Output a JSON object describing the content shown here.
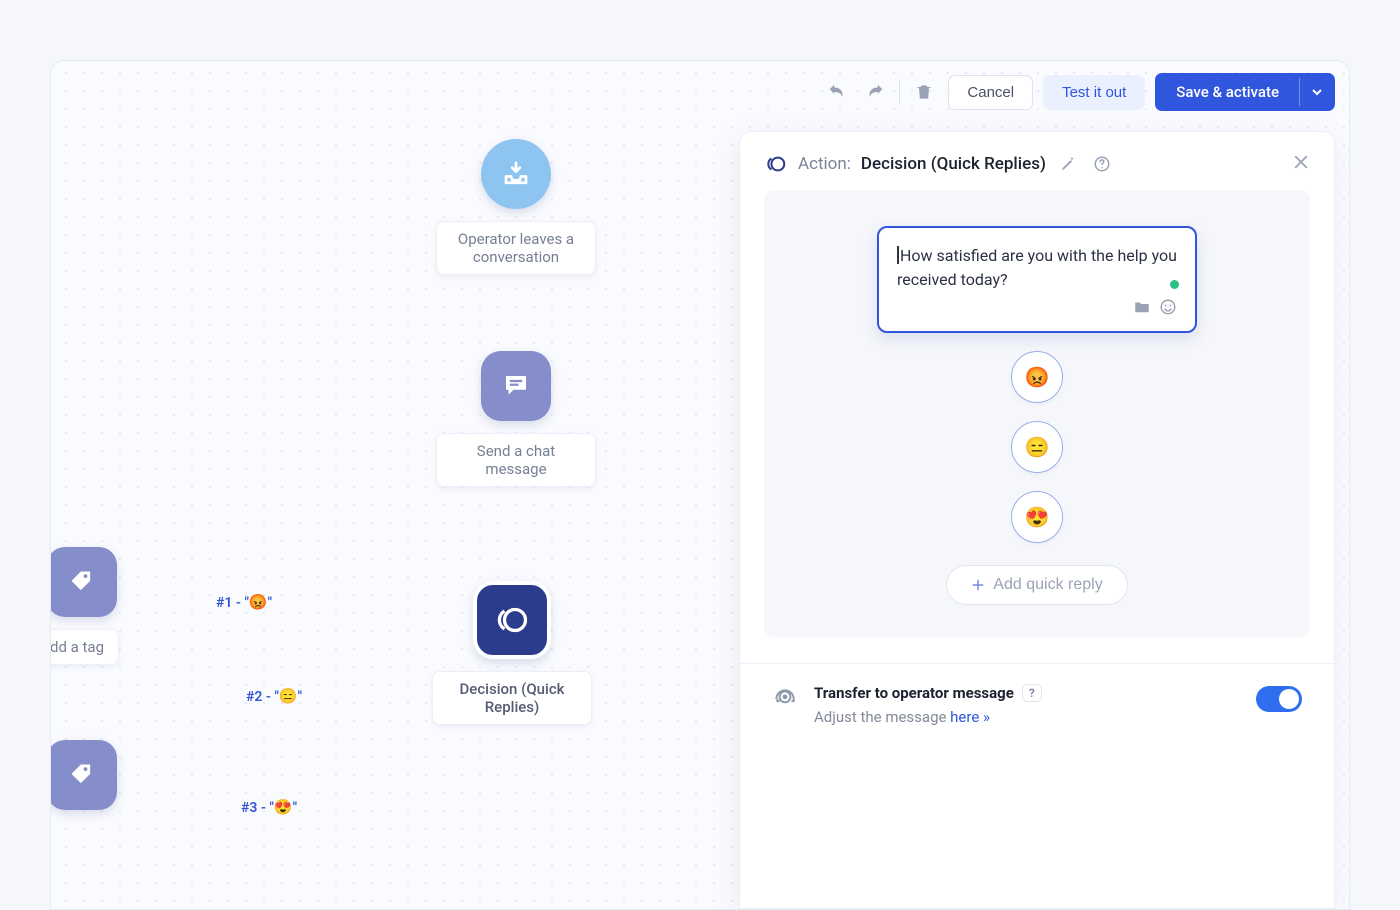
{
  "toolbar": {
    "cancel": "Cancel",
    "test": "Test it out",
    "save": "Save & activate"
  },
  "nodes": {
    "start": "Operator leaves a conversation",
    "send_chat": "Send a chat message",
    "decision": "Decision (Quick Replies)",
    "add_tag": "dd a tag"
  },
  "edges": {
    "e1_prefix": "#1 - \"",
    "e1_emoji": "😡",
    "e1_suffix": "\"",
    "e2_prefix": "#2 - \"",
    "e2_emoji": "😑",
    "e2_suffix": "\"",
    "e3_prefix": "#3 - \"",
    "e3_emoji": "😍",
    "e3_suffix": "\""
  },
  "panel": {
    "action_prefix": "Action:",
    "action_name": "Decision (Quick Replies)",
    "prompt_text": "How satisfied are you with the help you received today?",
    "reply1": "😡",
    "reply2": "😑",
    "reply3": "😍",
    "add_reply": "Add quick reply",
    "transfer_title": "Transfer to operator message",
    "transfer_help": "?",
    "transfer_sub_pre": "Adjust the message ",
    "transfer_link": "here »"
  }
}
